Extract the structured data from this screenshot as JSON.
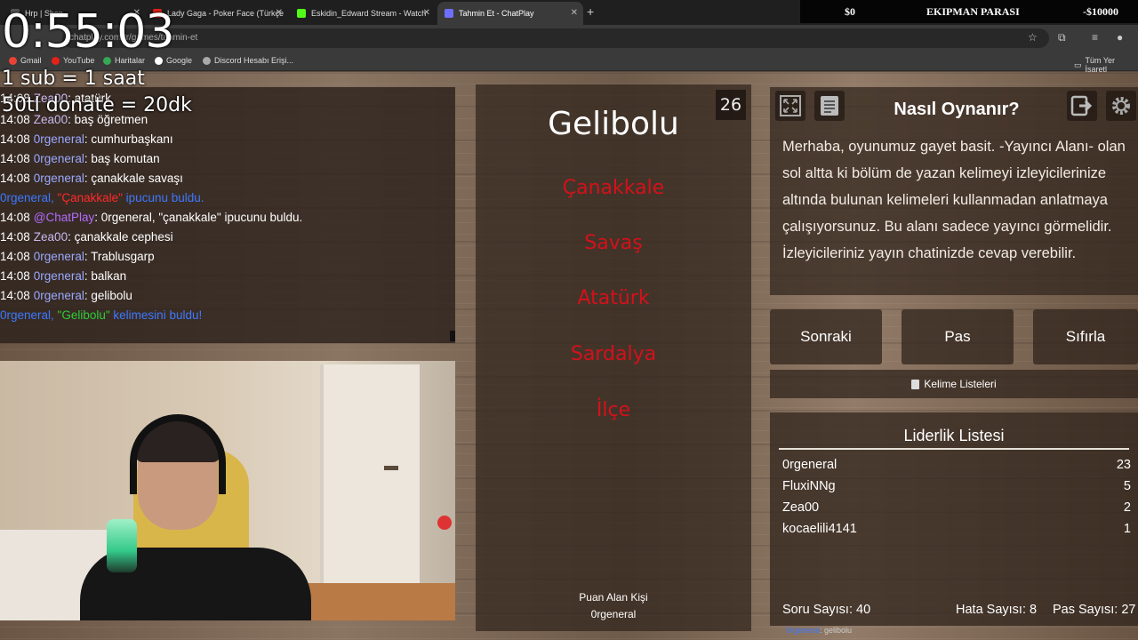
{
  "browser": {
    "tabs": [
      {
        "title": "Hrp | Shop",
        "color": "#555555"
      },
      {
        "title": "Lady Gaga - Poker Face (Türkçe",
        "color": "#e62117"
      },
      {
        "title": "Eskidin_Edward Stream - Watch",
        "color": "#53fc18"
      },
      {
        "title": "Tahmin Et - ChatPlay",
        "color": "#6f6fff"
      }
    ],
    "new_tab": "+",
    "url": "chatplay.com.tr/games/tahmin-et",
    "bookmarks": [
      "Gmail",
      "YouTube",
      "Haritalar",
      "Google",
      "Discord Hesabı Erişi..."
    ],
    "bookmarks_right": "Tüm Yer İşaretl"
  },
  "overlay": {
    "timer": "0:55:03",
    "note_sub": "1 sub = 1 saat",
    "note_donate": "50tl donate =  20dk",
    "equip_left": "$0",
    "equip_title": "EKIPMAN PARASI",
    "equip_right": "-$10000"
  },
  "chat": {
    "lines": [
      {
        "time": "14:08",
        "user": "Zea00",
        "user_color": "#c9b9f0",
        "msg": "atatürk"
      },
      {
        "time": "14:08",
        "user": "Zea00",
        "user_color": "#c9b9f0",
        "msg": "baş öğretmen"
      },
      {
        "time": "14:08",
        "user": "0rgeneral",
        "user_color": "#9aa8ff",
        "msg": "cumhurbaşkanı"
      },
      {
        "time": "14:08",
        "user": "0rgeneral",
        "user_color": "#9aa8ff",
        "msg": "baş komutan"
      },
      {
        "time": "14:08",
        "user": "0rgeneral",
        "user_color": "#9aa8ff",
        "msg": "çanakkale savaşı"
      }
    ],
    "sys1": {
      "pre": "0rgeneral, ",
      "word": "\"Çanakkale\"",
      "post": " ipucunu buldu."
    },
    "chatplay_line": {
      "time": "14:08",
      "user": "@ChatPlay",
      "user_color": "#b06cff",
      "msg": "0rgeneral, \"çanakkale\" ipucunu buldu."
    },
    "lines2": [
      {
        "time": "14:08",
        "user": "Zea00",
        "user_color": "#c9b9f0",
        "msg": "çanakkale cephesi"
      },
      {
        "time": "14:08",
        "user": "0rgeneral",
        "user_color": "#9aa8ff",
        "msg": "Trablusgarp"
      },
      {
        "time": "14:08",
        "user": "0rgeneral",
        "user_color": "#9aa8ff",
        "msg": "balkan"
      },
      {
        "time": "14:08",
        "user": "0rgeneral",
        "user_color": "#9aa8ff",
        "msg": "gelibolu"
      }
    ],
    "sys2": {
      "pre": "0rgeneral, ",
      "word": "\"Gelibolu\"",
      "post": " kelimesini buldu!"
    }
  },
  "card": {
    "count": "26",
    "word": "Gelibolu",
    "forbidden": [
      "Çanakkale",
      "Savaş",
      "Atatürk",
      "Sardalya",
      "İlçe"
    ],
    "scorer_label": "Puan Alan Kişi",
    "scorer_name": "0rgeneral"
  },
  "info": {
    "title": "Nasıl Oynanır?",
    "text": "Merhaba, oyunumuz gayet basit. -Yayıncı Alanı- olan sol altta ki bölüm de yazan kelimeyi izleyicilerinize altında bulunan kelimeleri kullanmadan anlatmaya çalışıyorsunuz. Bu alanı sadece yayıncı görmelidir. İzleyicileriniz yayın chatinizde cevap verebilir."
  },
  "actions": {
    "next": "Sonraki",
    "pass": "Pas",
    "reset": "Sıfırla",
    "word_lists": "Kelime Listeleri"
  },
  "leaderboard": {
    "title": "Liderlik Listesi",
    "rows": [
      {
        "name": "0rgeneral",
        "score": "23"
      },
      {
        "name": "FluxiNNg",
        "score": "5"
      },
      {
        "name": "Zea00",
        "score": "2"
      },
      {
        "name": "kocaelili4141",
        "score": "1"
      }
    ],
    "question_count": "Soru Sayısı: 40",
    "error_count": "Hata Sayısı: 8",
    "pass_count": "Pas Sayısı: 27"
  },
  "ticker": {
    "user": "0rgeneral",
    "msg": ": gelibolu"
  }
}
